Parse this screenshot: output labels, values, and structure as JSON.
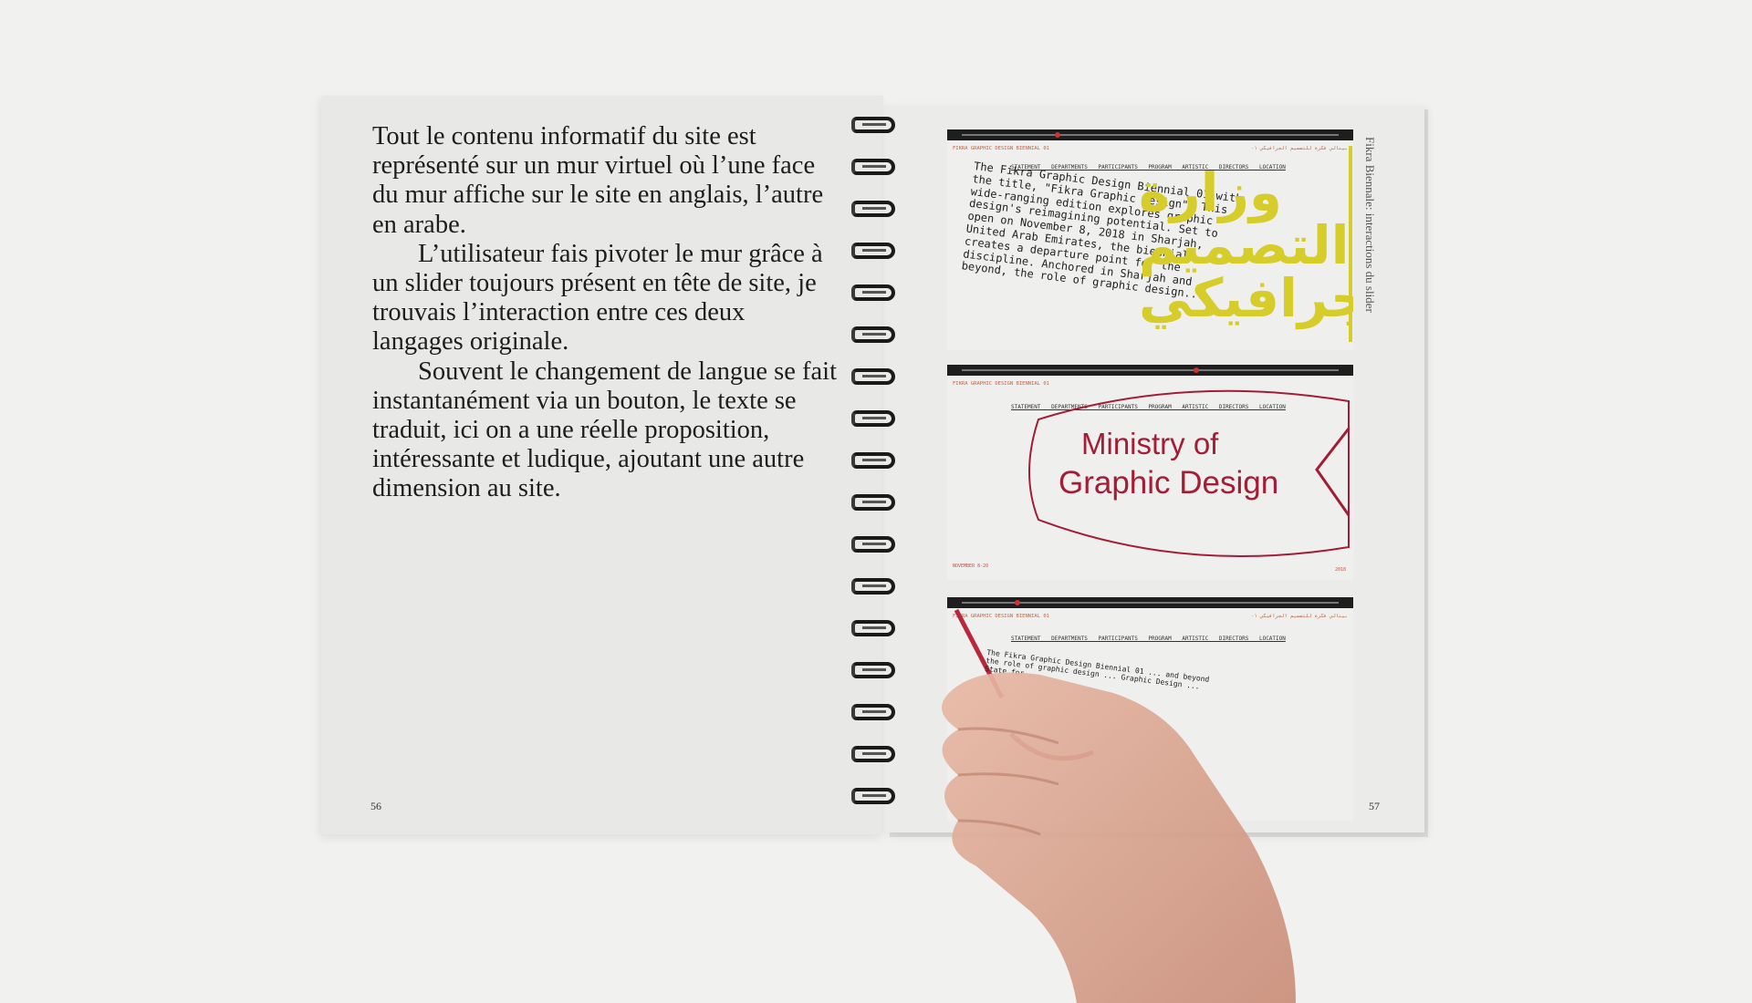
{
  "left_page": {
    "paragraphs": [
      "Tout le contenu informatif du site est représenté sur un mur virtuel où l’une face du mur affiche sur le site en anglais, l’autre en arabe.",
      "L’utilisateur fais pivoter le mur grâce à un slider toujours présent en tête de site, je trouvais l’interaction entre ces deux langages originale.",
      "Souvent le changement de langue se fait instantanément via un bouton, le texte se traduit,  ici on a une réelle proposition, intéressante et ludique, ajoutant une autre dimension au site."
    ],
    "page_number": "56"
  },
  "right_page": {
    "side_label": "Fikra Biennale: interactions du slider",
    "page_number": "57",
    "year_mark": "2018",
    "screens": [
      {
        "header_left": "FIKRA GRAPHIC DESIGN BIENNIAL 01",
        "header_right": "بينالي فكرة للتصميم الجرافيكي ٠١",
        "nav": "STATEMENT DEPARTMENTS PARTICIPANTS PROGRAM ARTISTIC DIRECTORS LOCATION",
        "body": "The Fikra Graphic Design Biennial 01 with the title, \"Fikra Graphic Design\". This wide-ranging edition explores graphic design's reimagining potential. Set to open on November 8, 2018 in Sharjah, United Arab Emirates, the biennial creates a departure point for the discipline. Anchored in Sharjah and beyond, the role of graphic design...",
        "arabic": "وزارة التصميم الجرافيكي"
      },
      {
        "header_left": "FIKRA GRAPHIC DESIGN BIENNIAL 01",
        "nav": "STATEMENT DEPARTMENTS PARTICIPANTS PROGRAM ARTISTIC DIRECTORS LOCATION",
        "title_line1": "Ministry of",
        "title_line2": "Graphic Design",
        "date": "NOVEMBER 8-20",
        "year": "2018"
      },
      {
        "header_left": "FIKRA GRAPHIC DESIGN BIENNIAL 01",
        "header_right": "بينالي فكرة للتصميم الجرافيكي ٠١",
        "nav": "STATEMENT DEPARTMENTS PARTICIPANTS PROGRAM ARTISTIC DIRECTORS LOCATION",
        "body": "The Fikra Graphic Design Biennial 01 ... and beyond the role of graphic design ... Graphic Design ... State for ..."
      }
    ]
  },
  "colors": {
    "ink": "#1d1d1d",
    "accent_red": "#a21d35",
    "accent_yellow": "#d6cc2a",
    "paper": "#e8e8e7",
    "background": "#f1f1f0"
  }
}
